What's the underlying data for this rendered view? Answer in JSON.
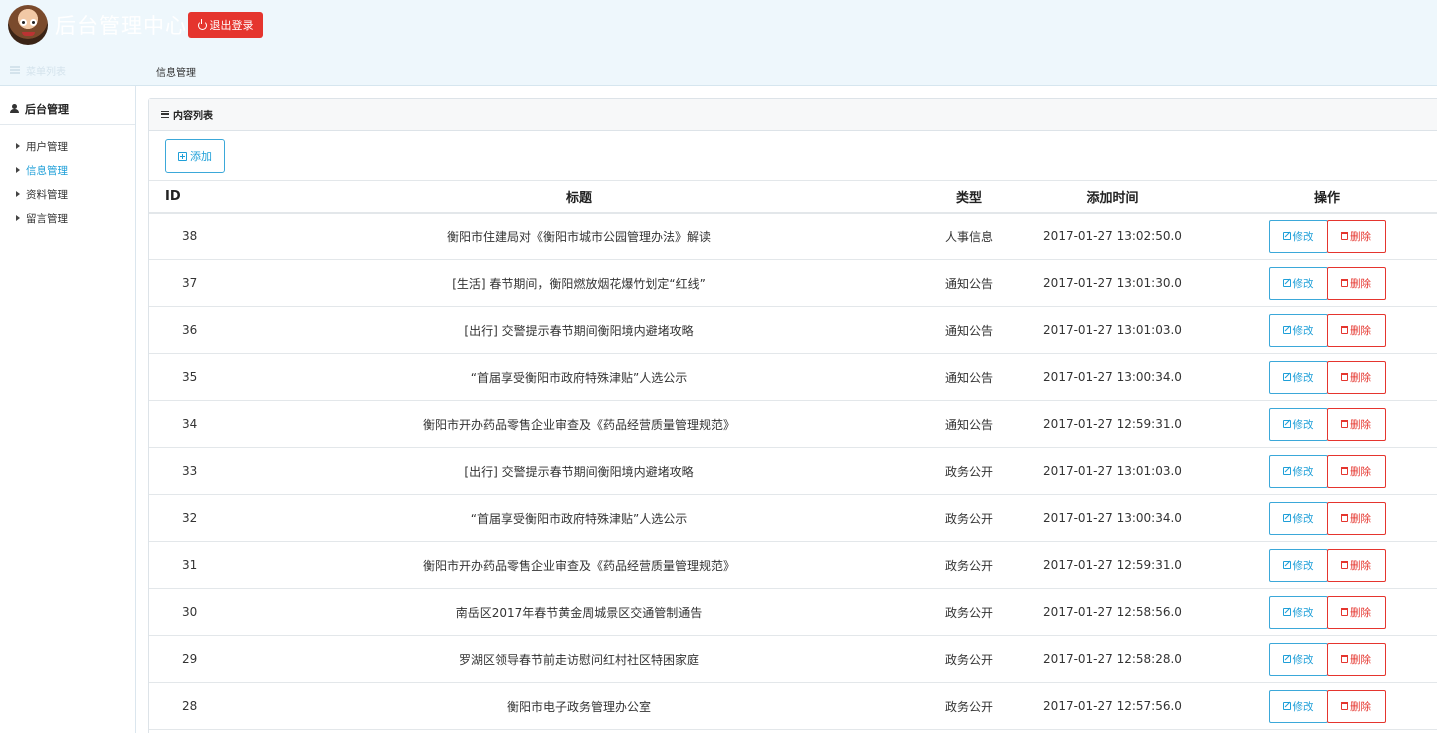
{
  "header": {
    "app_title": "后台管理中心",
    "logout_label": "退出登录"
  },
  "subbar": {
    "menu_toggle_label": "菜单列表",
    "breadcrumb": "信息管理"
  },
  "sidebar": {
    "section_title": "后台管理",
    "items": [
      {
        "label": "用户管理",
        "active": false
      },
      {
        "label": "信息管理",
        "active": true
      },
      {
        "label": "资料管理",
        "active": false
      },
      {
        "label": "留言管理",
        "active": false
      }
    ]
  },
  "panel": {
    "title": "内容列表",
    "add_label": "添加"
  },
  "table": {
    "headers": {
      "id": "ID",
      "title": "标题",
      "type": "类型",
      "time": "添加时间",
      "ops": "操作"
    },
    "edit_label": "修改",
    "delete_label": "删除",
    "rows": [
      {
        "id": "38",
        "title": "衡阳市住建局对《衡阳市城市公园管理办法》解读",
        "type": "人事信息",
        "time": "2017-01-27 13:02:50.0"
      },
      {
        "id": "37",
        "title": "[生活] 春节期间，衡阳燃放烟花爆竹划定“红线”",
        "type": "通知公告",
        "time": "2017-01-27 13:01:30.0"
      },
      {
        "id": "36",
        "title": "[出行] 交警提示春节期间衡阳境内避堵攻略",
        "type": "通知公告",
        "time": "2017-01-27 13:01:03.0"
      },
      {
        "id": "35",
        "title": "“首届享受衡阳市政府特殊津贴”人选公示",
        "type": "通知公告",
        "time": "2017-01-27 13:00:34.0"
      },
      {
        "id": "34",
        "title": "衡阳市开办药品零售企业审查及《药品经营质量管理规范》",
        "type": "通知公告",
        "time": "2017-01-27 12:59:31.0"
      },
      {
        "id": "33",
        "title": "[出行] 交警提示春节期间衡阳境内避堵攻略",
        "type": "政务公开",
        "time": "2017-01-27 13:01:03.0"
      },
      {
        "id": "32",
        "title": "“首届享受衡阳市政府特殊津贴”人选公示",
        "type": "政务公开",
        "time": "2017-01-27 13:00:34.0"
      },
      {
        "id": "31",
        "title": "衡阳市开办药品零售企业审查及《药品经营质量管理规范》",
        "type": "政务公开",
        "time": "2017-01-27 12:59:31.0"
      },
      {
        "id": "30",
        "title": "南岳区2017年春节黄金周城景区交通管制通告",
        "type": "政务公开",
        "time": "2017-01-27 12:58:56.0"
      },
      {
        "id": "29",
        "title": "罗湖区领导春节前走访慰问红村社区特困家庭",
        "type": "政务公开",
        "time": "2017-01-27 12:58:28.0"
      },
      {
        "id": "28",
        "title": "衡阳市电子政务管理办公室",
        "type": "政务公开",
        "time": "2017-01-27 12:57:56.0"
      }
    ]
  },
  "colors": {
    "accent": "#1e9fd8",
    "danger": "#e5352e",
    "header_bg": "#eef7fc"
  }
}
